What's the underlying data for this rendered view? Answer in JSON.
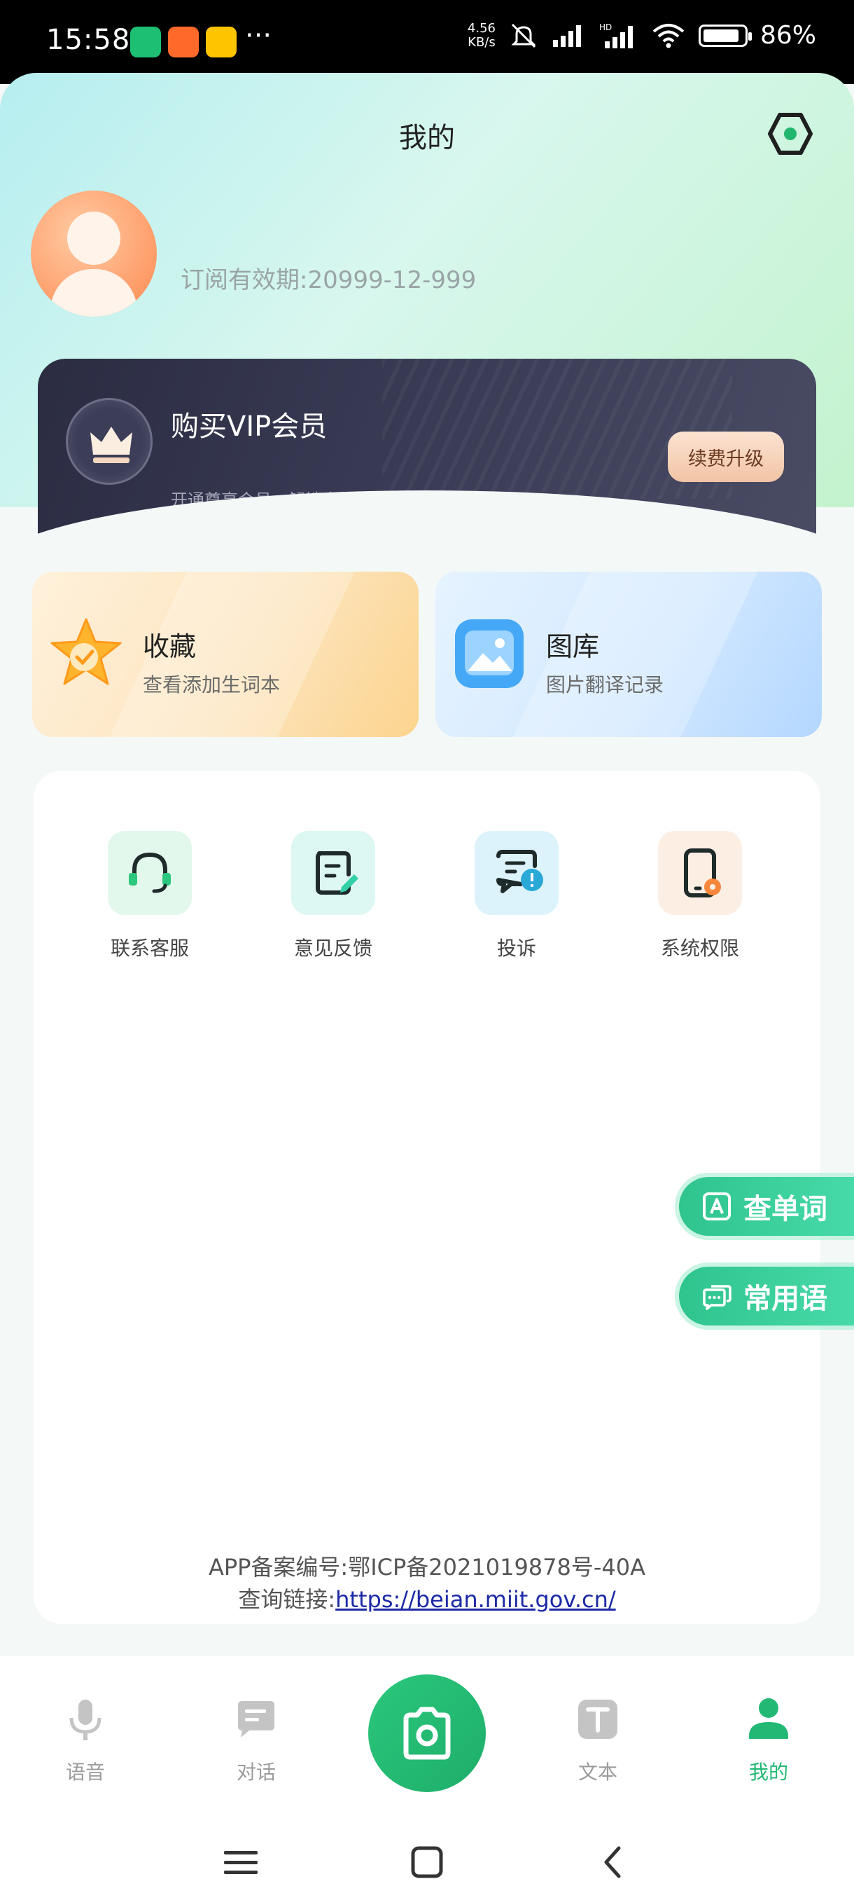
{
  "status_bar": {
    "time": "15:58",
    "net_speed_value": "4.56",
    "net_speed_unit": "KB/s",
    "more": "···",
    "hd": "HD",
    "battery": "86%"
  },
  "header": {
    "title": "我的"
  },
  "profile": {
    "subscription_text": "订阅有效期:20999-12-999"
  },
  "vip": {
    "title": "购买VIP会员",
    "description": "开通尊享会员，解锁全部专属权益",
    "button_label": "续费升级"
  },
  "features": [
    {
      "title": "收藏",
      "description": "查看添加生词本"
    },
    {
      "title": "图库",
      "description": "图片翻译记录"
    }
  ],
  "tools": [
    {
      "label": "联系客服",
      "icon": "headset-icon"
    },
    {
      "label": "意见反馈",
      "icon": "feedback-icon"
    },
    {
      "label": "投诉",
      "icon": "complaint-icon"
    },
    {
      "label": "系统权限",
      "icon": "phone-settings-icon"
    }
  ],
  "floating": {
    "lookup_word": "查单词",
    "common_phrases": "常用语"
  },
  "footer": {
    "icp_record": "APP备案编号:鄂ICP备2021019878号-40A",
    "query_prefix": "查询链接:",
    "query_link": "https://beian.miit.gov.cn/"
  },
  "tabbar": {
    "items": [
      {
        "label": "语音",
        "icon": "microphone-icon"
      },
      {
        "label": "对话",
        "icon": "chat-icon"
      },
      {
        "label": "文本",
        "icon": "text-icon"
      },
      {
        "label": "我的",
        "icon": "person-icon",
        "active": true
      }
    ],
    "camera": "camera-icon"
  },
  "colors": {
    "accent": "#23b874",
    "vip_dark": "#2b2c42",
    "floating_green": "#2fc48e"
  }
}
